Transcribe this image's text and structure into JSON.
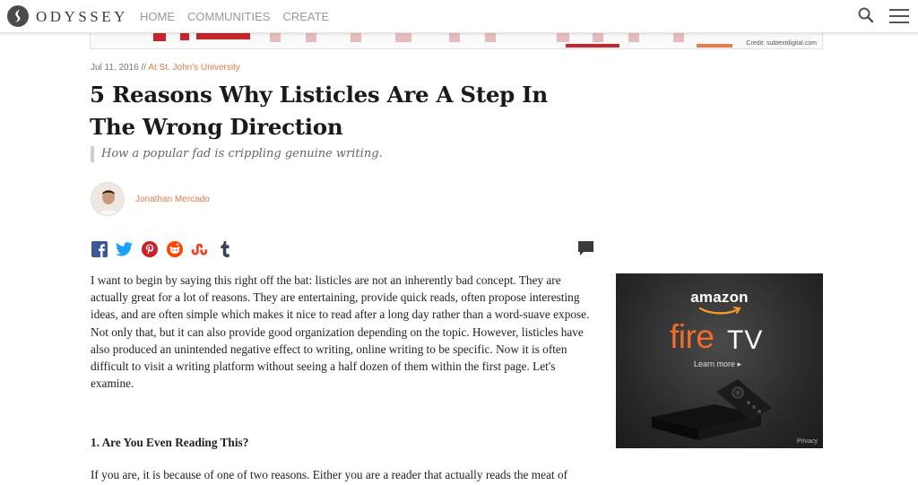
{
  "header": {
    "logo_text": "ODYSSEY",
    "nav": [
      "HOME",
      "COMMUNITIES",
      "CREATE"
    ]
  },
  "hero": {
    "credit": "Credit: subtextdigital.com"
  },
  "article": {
    "date": "Jul 11, 2016",
    "separator": "//",
    "school": "At St. John's University",
    "title": "5 Reasons Why Listicles Are A Step In The Wrong Direction",
    "subtitle": "How a popular fad is crippling genuine writing.",
    "author": "Jonathan Mercado",
    "paragraph_1": "I want to begin by saying this right off the bat: listicles are not an inherently bad concept. They are actually great for a lot of reasons. They are entertaining, provide quick reads, often propose interesting ideas, and are often simple which makes it nice to read after a long day rather than a word-suave expose. Not only that, but it can also provide good organization depending on the topic. However, listicles have also produced an unintended negative effect to writing, online writing to be specific. Now it is often difficult to visit a writing platform without seeing a half dozen of them within the first page. Let's examine.",
    "section_1_heading": "1. Are You Even Reading This?",
    "paragraph_2": "If you are, it is because of one of two reasons. Either you are a reader that actually reads the meat of"
  },
  "share_icons": [
    "facebook-icon",
    "twitter-icon",
    "pinterest-icon",
    "reddit-icon",
    "stumbleupon-icon",
    "tumblr-icon"
  ],
  "ad": {
    "brand": "amazon",
    "product_fire": "fire",
    "product_tv": "TV",
    "cta": "Learn more ▸",
    "privacy": "Privacy"
  },
  "colors": {
    "accent": "#e07a4a",
    "ad_fire": "#f26c2c",
    "facebook": "#3b5998",
    "twitter": "#1da1f2",
    "pinterest": "#cb2027",
    "reddit": "#ff4500",
    "stumbleupon": "#eb4924",
    "tumblr": "#35465c"
  }
}
